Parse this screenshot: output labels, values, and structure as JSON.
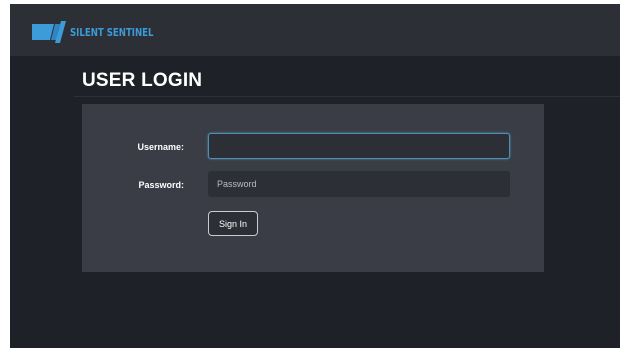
{
  "header": {
    "brand_name": "SILENT SENTINEL",
    "brand_color": "#3d9bd8",
    "logo_icon": "silent-sentinel-logo"
  },
  "page": {
    "title": "USER LOGIN"
  },
  "login_form": {
    "username_label": "Username:",
    "username_value": "",
    "username_placeholder": "",
    "password_label": "Password:",
    "password_value": "",
    "password_placeholder": "Password",
    "signin_label": "Sign In",
    "focus_color": "#4f8fb4"
  }
}
